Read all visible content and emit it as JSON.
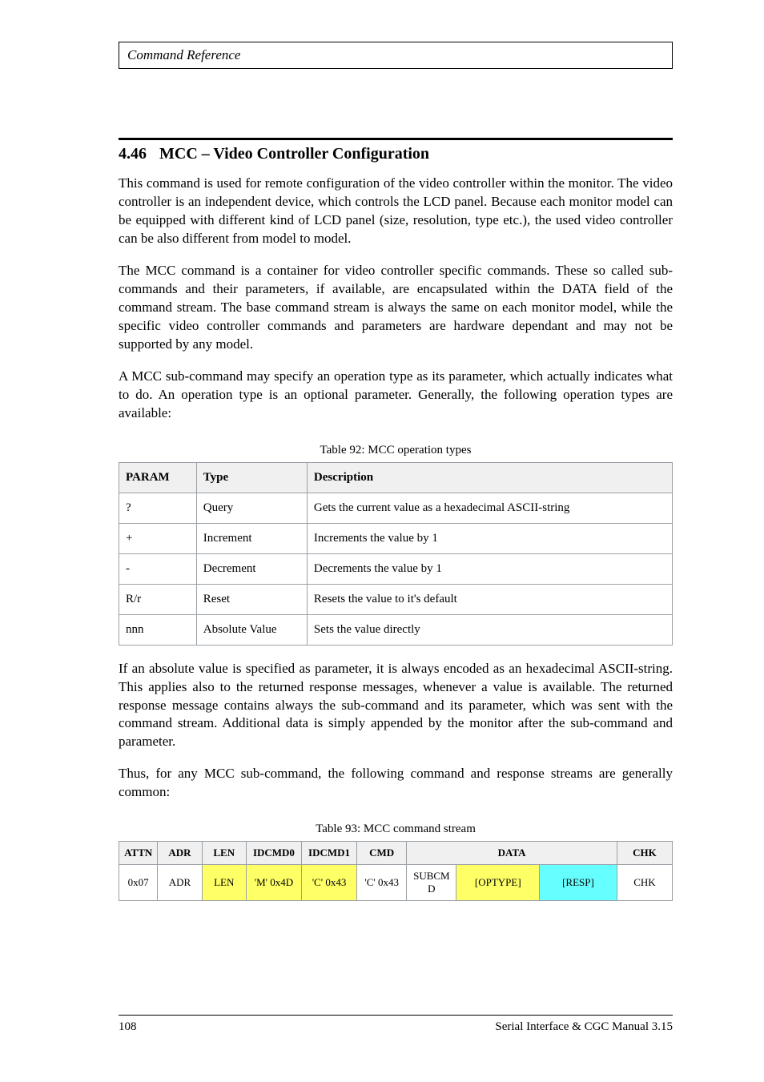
{
  "header": {
    "title": "Command Reference"
  },
  "section": {
    "number": "4.46",
    "title": "MCC – Video Controller Configuration"
  },
  "paragraphs": {
    "p1": "This command is used for remote configuration of the video controller within the monitor. The video controller is an independent device, which controls the LCD panel. Because each monitor model can be equipped with different kind of LCD panel (size, resolution, type etc.), the used video controller can be also different from model to model.",
    "p2": "The MCC command is a container for video controller specific commands. These so called sub-commands and their parameters, if available, are encapsulated within the DATA field of the command stream. The base command stream is always the same on each monitor model, while the specific video controller commands and parameters are hardware dependant and may not be supported by any model.",
    "p3": "A MCC sub-command may specify an operation type as its parameter, which actually indicates what to do. An operation type is an optional parameter. Generally, the following operation types are available:",
    "p4": "If an absolute value is specified as parameter, it is always encoded as an hexadecimal ASCII-string. This applies also to the returned response messages, whenever a value is available. The returned response message contains always the sub-command and its parameter, which was sent with the command stream. Additional data is simply appended by the monitor after the sub-command and parameter.",
    "p5": "Thus, for any MCC sub-command, the following command and response streams are generally common:"
  },
  "ops_table": {
    "caption": "Table 92: MCC operation types",
    "headers": {
      "h1": "PARAM",
      "h2": "Type",
      "h3": "Description"
    },
    "rows": [
      {
        "param": "?",
        "type": "Query",
        "desc": "Gets the current value as a hexadecimal ASCII-string"
      },
      {
        "param": "+",
        "type": "Increment",
        "desc": "Increments the value by 1"
      },
      {
        "param": "-",
        "type": "Decrement",
        "desc": "Decrements the value by 1"
      },
      {
        "param": "R/r",
        "type": "Reset",
        "desc": "Resets the value to it's default"
      },
      {
        "param": "nnn",
        "type": "Absolute Value",
        "desc": "Sets the value directly"
      }
    ]
  },
  "stream_table": {
    "caption": "Table 93: MCC command stream",
    "headers": {
      "s": "ATTN",
      "adr": "ADR",
      "len": "LEN",
      "id0": "IDCMD0",
      "id1": "IDCMD1",
      "cmd": "CMD",
      "da": "DATA",
      "chk": "CHK"
    },
    "row": {
      "s": "0x07",
      "adr": "ADR",
      "len": "LEN",
      "id0": "'M' 0x4D",
      "id1": "'C' 0x43",
      "cmd": "'C' 0x43",
      "sub": "SUBCMD",
      "op_a": "[OPTYPE]",
      "op_b": "[RESP]",
      "chk": "CHK"
    }
  },
  "footer": {
    "page": "108",
    "doc": "Serial Interface & CGC Manual 3.15"
  }
}
